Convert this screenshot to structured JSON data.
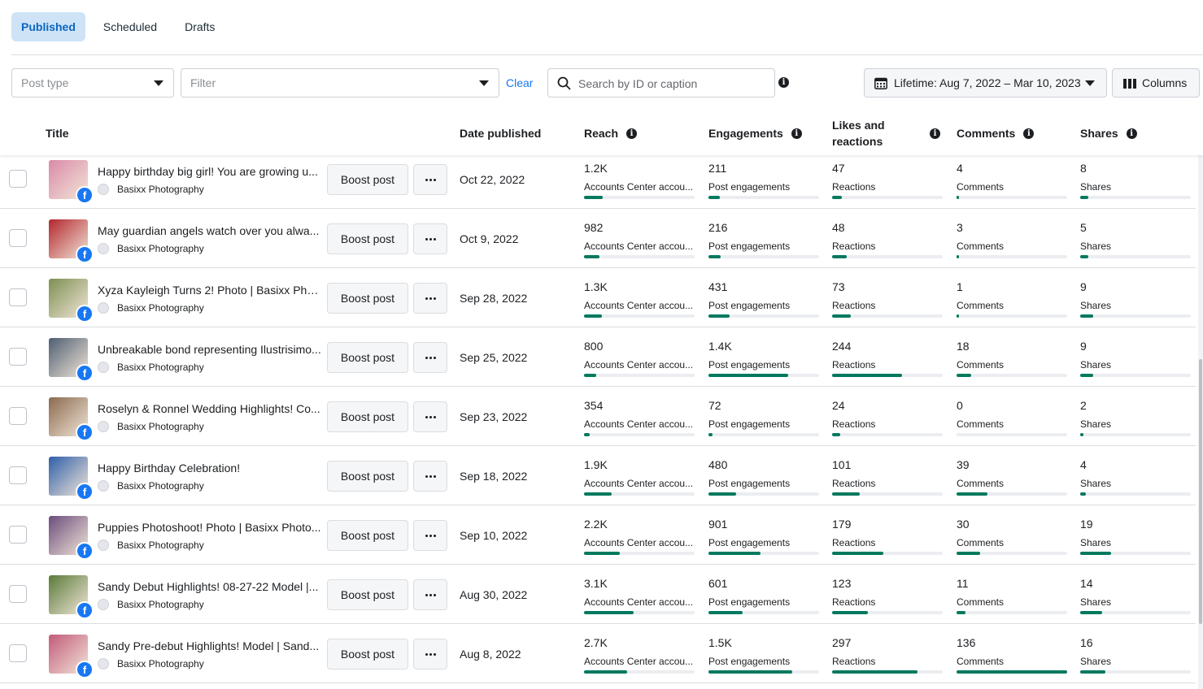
{
  "tabs": [
    {
      "label": "Published",
      "active": true
    },
    {
      "label": "Scheduled",
      "active": false
    },
    {
      "label": "Drafts",
      "active": false
    }
  ],
  "toolbar": {
    "post_type_placeholder": "Post type",
    "filter_placeholder": "Filter",
    "clear_label": "Clear",
    "search_placeholder": "Search by ID or caption",
    "date_range_label": "Lifetime: Aug 7, 2022 – Mar 10, 2023",
    "columns_label": "Columns"
  },
  "table": {
    "headers": {
      "title": "Title",
      "date": "Date published",
      "reach": "Reach",
      "engagements": "Engagements",
      "likes_line1": "Likes and",
      "likes_line2": "reactions",
      "comments": "Comments",
      "shares": "Shares"
    },
    "boost_label": "Boost post",
    "rows": [
      {
        "title": "Happy birthday big girl! You are growing u...",
        "page": "Basixx Photography",
        "date": "Oct 22, 2022",
        "reach": "1.2K",
        "reach_label": "Accounts Center accou...",
        "reach_pct": 0.17,
        "eng": "211",
        "eng_label": "Post engagements",
        "eng_pct": 0.1,
        "likes": "47",
        "likes_label": "Reactions",
        "likes_pct": 0.09,
        "comments": "4",
        "comments_label": "Comments",
        "comments_pct": 0.02,
        "shares": "8",
        "shares_label": "Shares",
        "shares_pct": 0.07,
        "thumb": "#d98aa8"
      },
      {
        "title": "May guardian angels watch over you alwa...",
        "page": "Basixx Photography",
        "date": "Oct 9, 2022",
        "reach": "982",
        "reach_label": "Accounts Center accou...",
        "reach_pct": 0.14,
        "eng": "216",
        "eng_label": "Post engagements",
        "eng_pct": 0.11,
        "likes": "48",
        "likes_label": "Reactions",
        "likes_pct": 0.13,
        "comments": "3",
        "comments_label": "Comments",
        "comments_pct": 0.02,
        "shares": "5",
        "shares_label": "Shares",
        "shares_pct": 0.07,
        "thumb": "#b3262e"
      },
      {
        "title": "Xyza Kayleigh Turns 2! Photo | Basixx Phot...",
        "page": "Basixx Photography",
        "date": "Sep 28, 2022",
        "reach": "1.3K",
        "reach_label": "Accounts Center accou...",
        "reach_pct": 0.16,
        "eng": "431",
        "eng_label": "Post engagements",
        "eng_pct": 0.19,
        "likes": "73",
        "likes_label": "Reactions",
        "likes_pct": 0.17,
        "comments": "1",
        "comments_label": "Comments",
        "comments_pct": 0.01,
        "shares": "9",
        "shares_label": "Shares",
        "shares_pct": 0.12,
        "thumb": "#7d8f52"
      },
      {
        "title": "Unbreakable bond representing Ilustrisimo...",
        "page": "Basixx Photography",
        "date": "Sep 25, 2022",
        "reach": "800",
        "reach_label": "Accounts Center accou...",
        "reach_pct": 0.11,
        "eng": "1.4K",
        "eng_label": "Post engagements",
        "eng_pct": 0.72,
        "likes": "244",
        "likes_label": "Reactions",
        "likes_pct": 0.63,
        "comments": "18",
        "comments_label": "Comments",
        "comments_pct": 0.13,
        "shares": "9",
        "shares_label": "Shares",
        "shares_pct": 0.12,
        "thumb": "#4e5e72"
      },
      {
        "title": "Roselyn & Ronnel Wedding Highlights! Co...",
        "page": "Basixx Photography",
        "date": "Sep 23, 2022",
        "reach": "354",
        "reach_label": "Accounts Center accou...",
        "reach_pct": 0.05,
        "eng": "72",
        "eng_label": "Post engagements",
        "eng_pct": 0.04,
        "likes": "24",
        "likes_label": "Reactions",
        "likes_pct": 0.07,
        "comments": "0",
        "comments_label": "Comments",
        "comments_pct": 0.0,
        "shares": "2",
        "shares_label": "Shares",
        "shares_pct": 0.03,
        "thumb": "#8a6a4f"
      },
      {
        "title": "Happy Birthday Celebration!",
        "page": "Basixx Photography",
        "date": "Sep 18, 2022",
        "reach": "1.9K",
        "reach_label": "Accounts Center accou...",
        "reach_pct": 0.25,
        "eng": "480",
        "eng_label": "Post engagements",
        "eng_pct": 0.25,
        "likes": "101",
        "likes_label": "Reactions",
        "likes_pct": 0.25,
        "comments": "39",
        "comments_label": "Comments",
        "comments_pct": 0.28,
        "shares": "4",
        "shares_label": "Shares",
        "shares_pct": 0.05,
        "thumb": "#2f5fa8"
      },
      {
        "title": "Puppies Photoshoot! Photo | Basixx Photo...",
        "page": "Basixx Photography",
        "date": "Sep 10, 2022",
        "reach": "2.2K",
        "reach_label": "Accounts Center accou...",
        "reach_pct": 0.32,
        "eng": "901",
        "eng_label": "Post engagements",
        "eng_pct": 0.47,
        "likes": "179",
        "likes_label": "Reactions",
        "likes_pct": 0.46,
        "comments": "30",
        "comments_label": "Comments",
        "comments_pct": 0.21,
        "shares": "19",
        "shares_label": "Shares",
        "shares_pct": 0.28,
        "thumb": "#6b4d7c"
      },
      {
        "title": "Sandy Debut Highlights! 08-27-22 Model |...",
        "page": "Basixx Photography",
        "date": "Aug 30, 2022",
        "reach": "3.1K",
        "reach_label": "Accounts Center accou...",
        "reach_pct": 0.45,
        "eng": "601",
        "eng_label": "Post engagements",
        "eng_pct": 0.31,
        "likes": "123",
        "likes_label": "Reactions",
        "likes_pct": 0.32,
        "comments": "11",
        "comments_label": "Comments",
        "comments_pct": 0.08,
        "shares": "14",
        "shares_label": "Shares",
        "shares_pct": 0.2,
        "thumb": "#5a7a3a"
      },
      {
        "title": "Sandy Pre-debut Highlights! Model | Sand...",
        "page": "Basixx Photography",
        "date": "Aug 8, 2022",
        "reach": "2.7K",
        "reach_label": "Accounts Center accou...",
        "reach_pct": 0.39,
        "eng": "1.5K",
        "eng_label": "Post engagements",
        "eng_pct": 0.76,
        "likes": "297",
        "likes_label": "Reactions",
        "likes_pct": 0.77,
        "comments": "136",
        "comments_label": "Comments",
        "comments_pct": 1.0,
        "shares": "16",
        "shares_label": "Shares",
        "shares_pct": 0.23,
        "thumb": "#c25a7a"
      }
    ]
  },
  "colors": {
    "accent": "#0a66c2",
    "active_tab_bg": "#cfe3f7",
    "bar_fill": "#00795e",
    "bar_track": "#ebedf0",
    "facebook": "#1877f2"
  },
  "icons": {
    "search": "search-icon",
    "info": "info-icon",
    "calendar": "calendar-icon",
    "columns": "columns-icon",
    "more": "more-icon",
    "facebook": "facebook-icon",
    "caret": "chevron-down-icon"
  }
}
